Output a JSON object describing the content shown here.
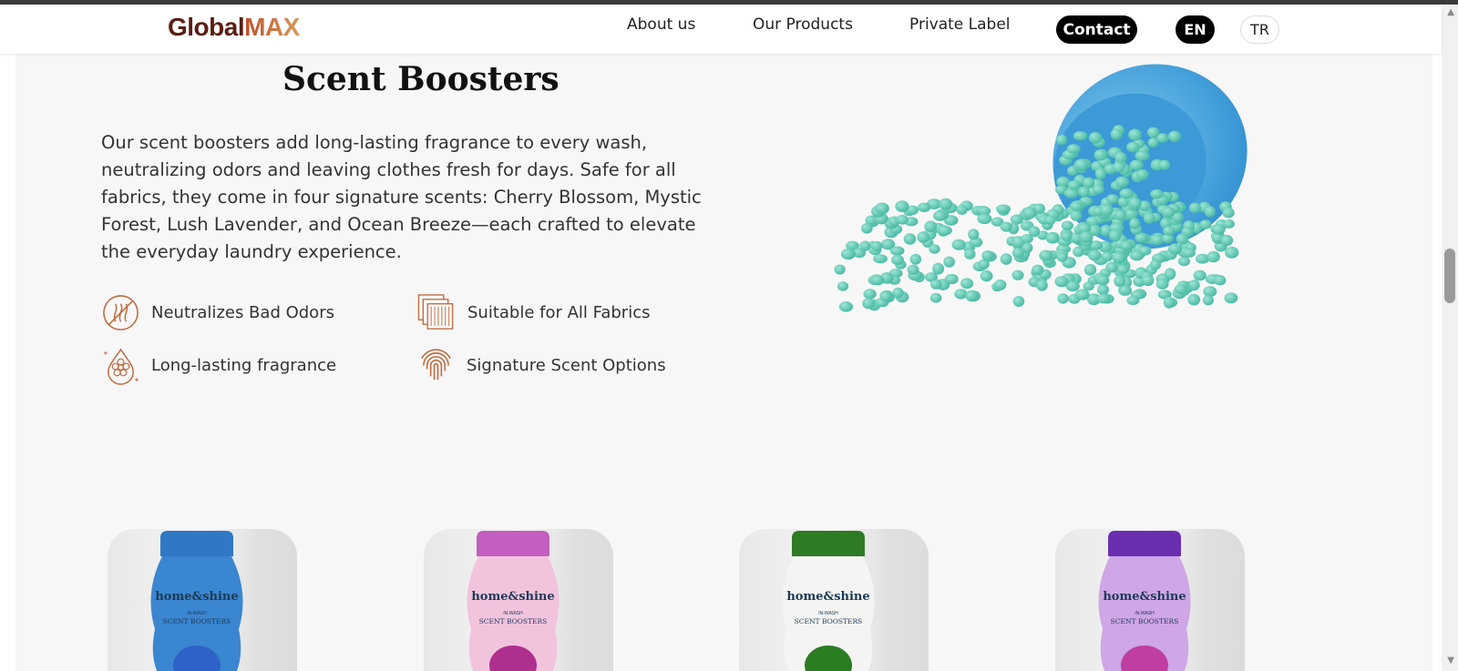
{
  "header": {
    "logo_part1": "Global",
    "logo_part2": "MAX",
    "nav": [
      "About us",
      "Our Products",
      "Private Label"
    ],
    "contact_label": "Contact",
    "languages": [
      "EN",
      "TR"
    ],
    "active_language": "EN"
  },
  "section": {
    "title": "Scent Boosters",
    "description": "Our scent boosters add long-lasting fragrance to every wash, neutralizing odors and leaving clothes fresh for days. Safe for all fabrics, they come in four signature scents: Cherry Blossom, Mystic Forest, Lush Lavender, and Ocean Breeze—each crafted to elevate the everyday laundry experience.",
    "features": [
      {
        "label": "Neutralizes Bad Odors",
        "icon": "no-odor-icon"
      },
      {
        "label": "Suitable for All Fabrics",
        "icon": "fabrics-icon"
      },
      {
        "label": "Long-lasting fragrance",
        "icon": "flower-drop-icon"
      },
      {
        "label": "Signature Scent Options",
        "icon": "fingerprint-icon"
      }
    ]
  },
  "products": [
    {
      "brand": "home&shine",
      "line1": "IN-WASH",
      "line2": "SCENT BOOSTERS",
      "cap": "#2f78c4",
      "body": "#3b86d0",
      "beads": "#2f63c8"
    },
    {
      "brand": "home&shine",
      "line1": "IN-WASH",
      "line2": "SCENT BOOSTERS",
      "cap": "#c25fc0",
      "body": "#f2c3dd",
      "beads": "#b0308f"
    },
    {
      "brand": "home&shine",
      "line1": "IN-WASH",
      "line2": "SCENT BOOSTERS",
      "cap": "#2f7a25",
      "body": "#f4f5f2",
      "beads": "#2b7d22"
    },
    {
      "brand": "home&shine",
      "line1": "IN-WASH",
      "line2": "SCENT BOOSTERS",
      "cap": "#6a2fb0",
      "body": "#cfa6e6",
      "beads": "#c03e9f"
    }
  ],
  "colors": {
    "accent_copper": "#c06a3c",
    "bead": "#5cc8b3",
    "bowl": "#4aa8e0"
  }
}
